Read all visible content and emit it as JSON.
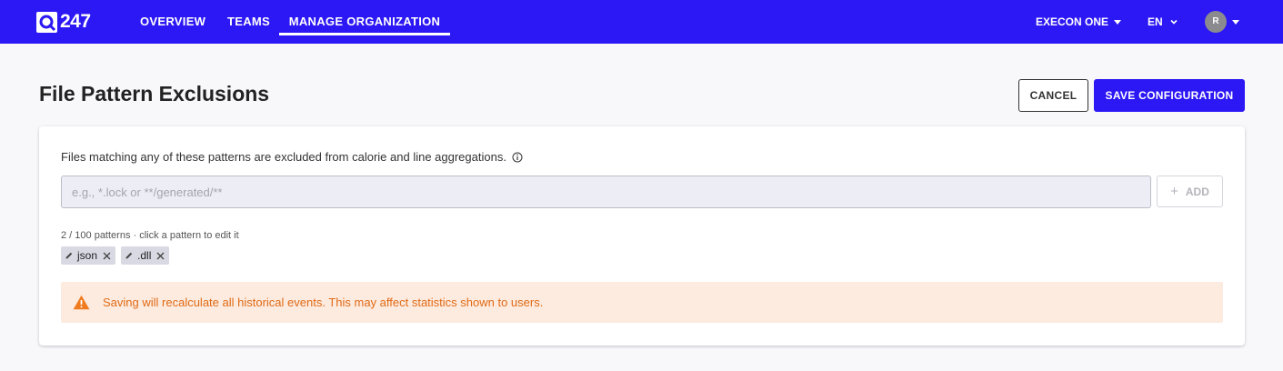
{
  "brand": {
    "logo_text": "247"
  },
  "nav": {
    "items": [
      {
        "label": "OVERVIEW"
      },
      {
        "label": "TEAMS"
      },
      {
        "label": "MANAGE ORGANIZATION",
        "active": true
      }
    ]
  },
  "header_right": {
    "org_label": "EXECON ONE",
    "lang_label": "EN",
    "avatar_initial": "R"
  },
  "page": {
    "title": "File Pattern Exclusions",
    "cancel_label": "CANCEL",
    "save_label": "SAVE CONFIGURATION"
  },
  "card": {
    "description": "Files matching any of these patterns are excluded from calorie and line aggregations.",
    "input_placeholder": "e.g., *.lock or **/generated/**",
    "input_value": "",
    "add_label": "ADD",
    "count_text": "2 / 100 patterns · click a pattern to edit it",
    "patterns": [
      {
        "label": "json"
      },
      {
        "label": ".dll"
      }
    ],
    "warning_text": "Saving will recalculate all historical events. This may affect statistics shown to users."
  },
  "colors": {
    "brand": "#2c17f5",
    "warning_bg": "#fdebdf",
    "warning_text": "#e06a16"
  }
}
